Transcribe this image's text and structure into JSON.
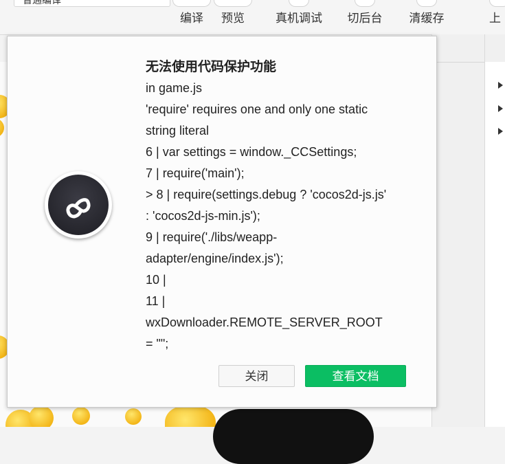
{
  "toolbar": {
    "mode_select": "普通编译",
    "buttons": [
      {
        "label": "编译"
      },
      {
        "label": "预览"
      },
      {
        "label": "真机调试"
      },
      {
        "label": "切后台"
      },
      {
        "label": "清缓存"
      },
      {
        "label": "上"
      }
    ]
  },
  "modal": {
    "title": "无法使用代码保护功能",
    "lines": [
      "in game.js",
      "'require' requires one and only one static",
      "string literal",
      "6 | var settings = window._CCSettings;",
      "7 | require('main');",
      "> 8 | require(settings.debug ? 'cocos2d-js.js'",
      ": 'cocos2d-js-min.js');",
      "9 | require('./libs/weapp-",
      "adapter/engine/index.js');",
      "10 |",
      "11 |",
      "wxDownloader.REMOTE_SERVER_ROOT",
      "= \"\";"
    ],
    "close_label": "关闭",
    "docs_label": "查看文档"
  },
  "colors": {
    "primary_button": "#0bbe63",
    "app_icon": "#1d1d23"
  }
}
